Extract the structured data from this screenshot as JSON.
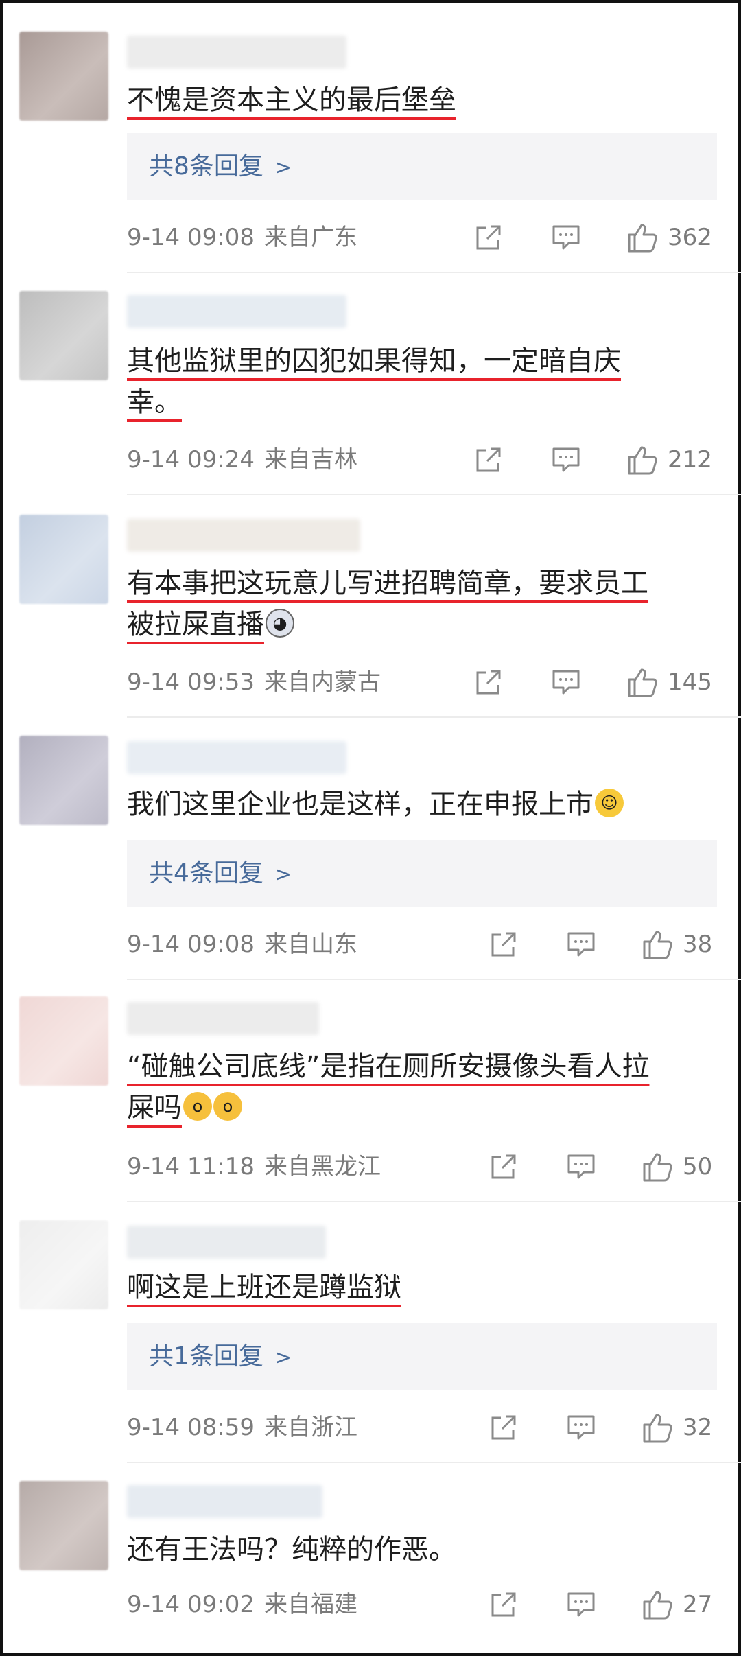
{
  "comments": [
    {
      "text": "不愧是资本主义的最后堡垒",
      "replies": "共8条回复",
      "time": "9-14 09:08",
      "location": "来自广东",
      "likes": "362"
    },
    {
      "text_line1": "其他监狱里的囚犯如果得知，一定暗自庆",
      "text_line2": "幸。",
      "time": "9-14 09:24",
      "location": "来自吉林",
      "likes": "212"
    },
    {
      "text_line1": "有本事把这玩意儿写进招聘简章，要求员工",
      "text_line2": "被拉屎直播",
      "emoji": "dog-emoji",
      "time": "9-14 09:53",
      "location": "来自内蒙古",
      "likes": "145"
    },
    {
      "text": "我们这里企业也是这样，正在申报上市",
      "emoji": "grin-emoji",
      "replies": "共4条回复",
      "time": "9-14 09:08",
      "location": "来自山东",
      "likes": "38"
    },
    {
      "text_line1": "“碰触公司底线”是指在厕所安摄像头看人拉",
      "text_line2": "屎吗",
      "emoji": "scared-emoji",
      "time": "9-14 11:18",
      "location": "来自黑龙江",
      "likes": "50"
    },
    {
      "text": "啊这是上班还是蹲监狱",
      "replies": "共1条回复",
      "time": "9-14 08:59",
      "location": "来自浙江",
      "likes": "32"
    },
    {
      "text": "还有王法吗？纯粹的作恶。",
      "time": "9-14 09:02",
      "location": "来自福建",
      "likes": "27"
    }
  ],
  "icons": {
    "share": "share-icon",
    "comment": "comment-icon",
    "like": "thumbs-up-icon",
    "chevron": "chevron-right-icon"
  },
  "colors": {
    "underline": "#e8232c",
    "reply_link": "#476a9a",
    "meta": "#7a7a7a",
    "reply_bg": "#f4f4f6"
  }
}
